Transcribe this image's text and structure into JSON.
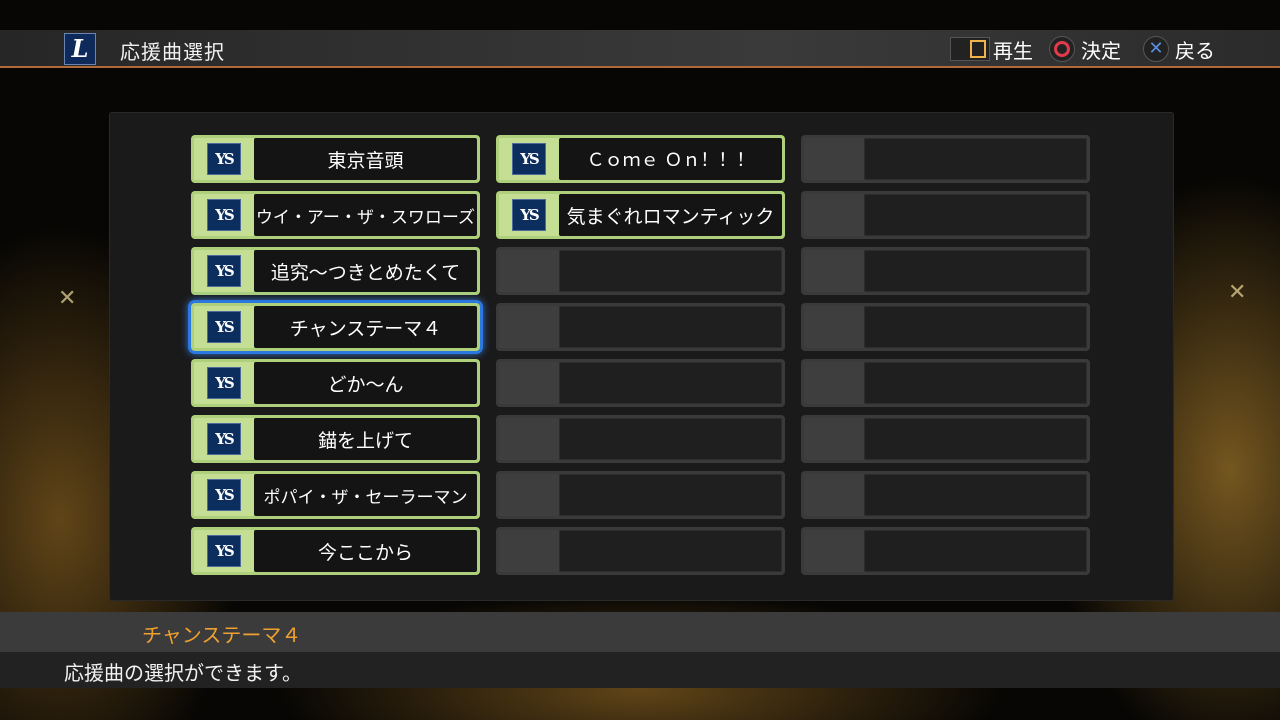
{
  "header": {
    "team_logo": "L",
    "title": "応援曲選択",
    "controls": [
      {
        "icon": "square-button-icon",
        "label": "再生"
      },
      {
        "icon": "circle-button-icon",
        "label": "決定"
      },
      {
        "icon": "cross-button-icon",
        "label": "戻る"
      }
    ]
  },
  "songs": {
    "badge_text": "YS",
    "items": [
      {
        "label": "東京音頭"
      },
      {
        "label": "ウイ・アー・ザ・スワローズ"
      },
      {
        "label": "追究〜つきとめたくて"
      },
      {
        "label": "チャンステーマ４"
      },
      {
        "label": "どか〜ん"
      },
      {
        "label": "錨を上げて"
      },
      {
        "label": "ポパイ・ザ・セーラーマン"
      },
      {
        "label": "今ここから"
      },
      {
        "label": "Ｃｏｍｅ Ｏｎ！！！"
      },
      {
        "label": "気まぐれロマンティック"
      }
    ],
    "selected_index": 3
  },
  "footer": {
    "selected_title": "チャンステーマ４",
    "description": "応援曲の選択ができます。"
  },
  "colors": {
    "slot_frame": "#aed07a",
    "selection": "#2a78e0",
    "header_accent": "#b06a3a",
    "footer_title": "#f0a030"
  }
}
